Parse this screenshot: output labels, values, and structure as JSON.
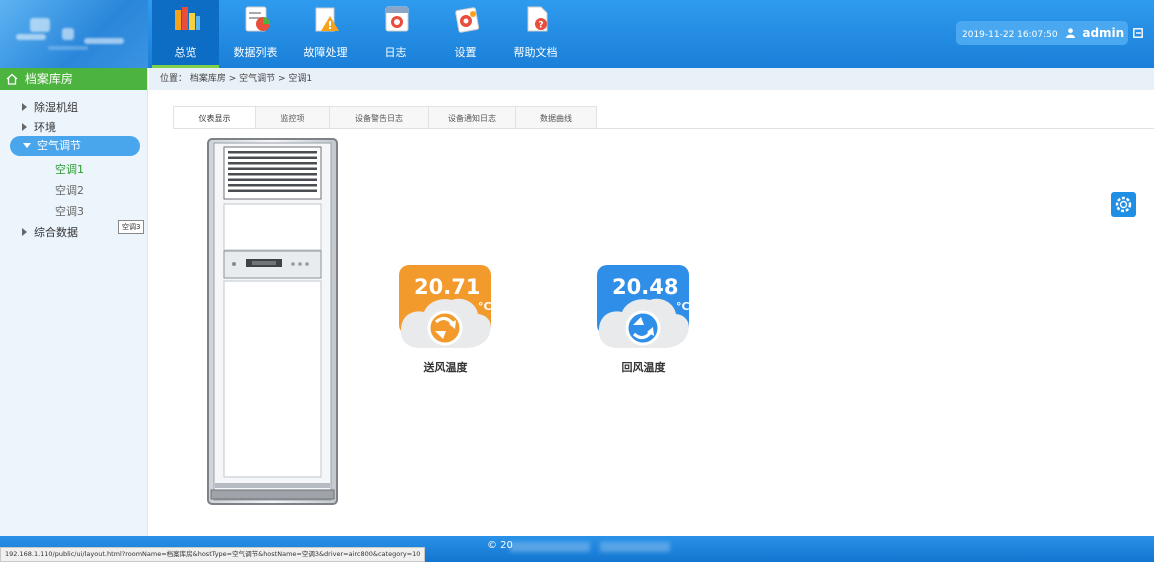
{
  "header": {
    "nav": [
      {
        "label": "总览",
        "icon": "books-icon",
        "active": true
      },
      {
        "label": "数据列表",
        "icon": "data-list-icon",
        "active": false
      },
      {
        "label": "故障处理",
        "icon": "warning-icon",
        "active": false
      },
      {
        "label": "日志",
        "icon": "log-icon",
        "active": false
      },
      {
        "label": "设置",
        "icon": "settings-icon",
        "active": false
      },
      {
        "label": "帮助文档",
        "icon": "help-doc-icon",
        "active": false
      }
    ],
    "datetime": "2019-11-22 16:07:50",
    "username": "admin"
  },
  "sidebar": {
    "title": "档案库房",
    "items": [
      {
        "label": "除湿机组"
      },
      {
        "label": "环境"
      },
      {
        "label": "空气调节"
      },
      {
        "label": "综合数据"
      }
    ],
    "sub_items": [
      {
        "label": "空调1",
        "selected": true
      },
      {
        "label": "空调2",
        "selected": false
      },
      {
        "label": "空调3",
        "selected": false
      }
    ],
    "tooltip": "空调3"
  },
  "breadcrumb": "位置： 档案库房 > 空气调节 > 空调1",
  "tabs": [
    {
      "label": "仪表显示",
      "active": true
    },
    {
      "label": "监控项",
      "active": false
    },
    {
      "label": "设备警告日志",
      "active": false
    },
    {
      "label": "设备通知日志",
      "active": false
    },
    {
      "label": "数据曲线",
      "active": false
    }
  ],
  "gauges": {
    "supply": {
      "value": "20.71",
      "unit": "°C",
      "label": "送风温度",
      "color": "#f39a2c"
    },
    "return": {
      "value": "20.48",
      "unit": "°C",
      "label": "回风温度",
      "color": "#2f8ee8"
    }
  },
  "footer": {
    "copyright": "© 20",
    "status_url": "192.168.1.110/public/ui/layout.html?roomName=档案库房&hostType=空气调节&hostName=空调3&driver=airc800&category=10"
  },
  "colors": {
    "header_blue": "#1f88e0",
    "active_green": "#4cb33f",
    "sidebar_bg": "#ecf5fc"
  }
}
